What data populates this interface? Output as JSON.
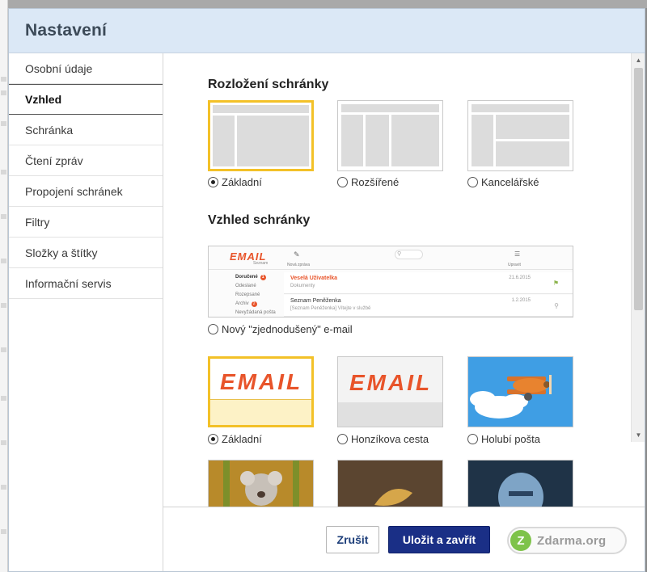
{
  "modal": {
    "title": "Nastavení"
  },
  "sidebar": {
    "items": [
      {
        "label": "Osobní údaje"
      },
      {
        "label": "Vzhled"
      },
      {
        "label": "Schránka"
      },
      {
        "label": "Čtení zpráv"
      },
      {
        "label": "Propojení schránek"
      },
      {
        "label": "Filtry"
      },
      {
        "label": "Složky a štítky"
      },
      {
        "label": "Informační servis"
      }
    ],
    "active_index": 1
  },
  "layout_section": {
    "title": "Rozložení schránky",
    "options": [
      {
        "label": "Základní",
        "selected": true
      },
      {
        "label": "Rozšířené",
        "selected": false
      },
      {
        "label": "Kancelářské",
        "selected": false
      }
    ]
  },
  "appearance_section": {
    "title": "Vzhled schránky",
    "new_email": {
      "label": "Nový \"zjednodušený\" e-mail",
      "selected": false,
      "preview": {
        "logo": "EMAIL",
        "logo_sub": "Seznam",
        "compose_label": "Nová zpráva",
        "settings_label": "Upravit",
        "folders": [
          {
            "label": "Doručené",
            "badge": "1"
          },
          {
            "label": "Odeslané"
          },
          {
            "label": "Rozepsané"
          },
          {
            "label": "Archiv",
            "badge": "2"
          },
          {
            "label": "Nevyžádaná pošta"
          }
        ],
        "messages": [
          {
            "sender": "Veselá Uživatelka",
            "subject": "Dokumenty",
            "date": "21.6.2015",
            "unread": true
          },
          {
            "sender": "Seznam Peněženka",
            "subject": "[Seznam Peněženka] Vítejte v službě",
            "date": "1.2.2015",
            "unread": false
          }
        ]
      }
    },
    "themes": [
      {
        "label": "Základní",
        "selected": true,
        "art": "EMAIL"
      },
      {
        "label": "Honzíkova cesta",
        "selected": false,
        "art": "EMAIL"
      },
      {
        "label": "Holubí pošta",
        "selected": false
      }
    ]
  },
  "footer": {
    "cancel_label": "Zrušit",
    "save_label": "Uložit a zavřít",
    "watermark": "Zdarma.org",
    "watermark_icon": "Z"
  },
  "colors": {
    "accent": "#f3c128",
    "primary_button": "#1a2f86",
    "header_bg": "#dbe8f6",
    "brand_orange": "#e8542a"
  }
}
